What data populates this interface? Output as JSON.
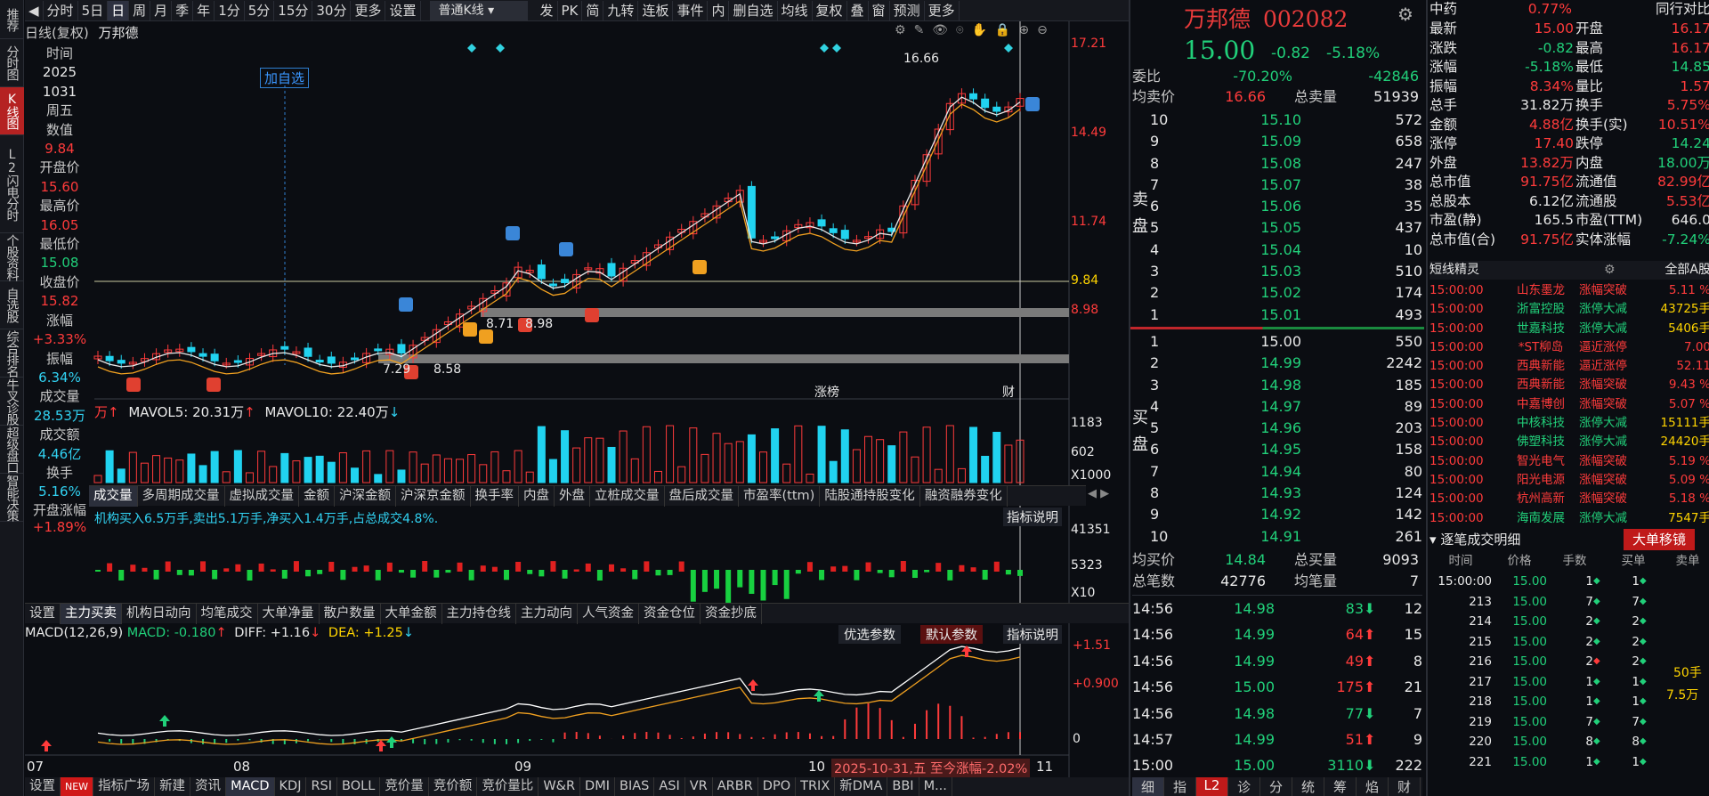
{
  "toolbar": {
    "items": [
      "分时",
      "5日",
      "日",
      "周",
      "月",
      "季",
      "年",
      "1分",
      "5分",
      "15分",
      "30分",
      "更多",
      "设置"
    ],
    "active": "日",
    "kline_select": "普通K线",
    "tools": [
      "发",
      "PK",
      "简",
      "九转",
      "连板",
      "事件",
      "内",
      "删自选",
      "均线",
      "复权",
      "叠",
      "窗",
      "预测",
      "更多"
    ]
  },
  "vnav": [
    "推荐",
    "分时图",
    "K线图",
    "L2闪电分时",
    "个股资料",
    "自选股",
    "综合排名",
    "牛叉诊股",
    "超级盘口",
    "智能决策"
  ],
  "chart_header": {
    "mode": "日线(复权)",
    "name": "万邦德",
    "add_watch": "加自选"
  },
  "info": {
    "labels": [
      "时间",
      "周五",
      "数值",
      "开盘价",
      "最高价",
      "最低价",
      "收盘价",
      "涨幅",
      "振幅",
      "成交量",
      "成交额",
      "换手",
      "开盘涨幅"
    ],
    "time_year": "2025",
    "time_date": "1031",
    "weekday": "周五",
    "value": "9.84",
    "open": "15.60",
    "high": "16.05",
    "low": "15.08",
    "close": "15.82",
    "chg": "+3.33%",
    "amp": "6.34%",
    "vol": "28.53万",
    "amt": "4.46亿",
    "turnover": "5.16%",
    "open_chg": "+1.89%"
  },
  "price_axis": [
    "17.21",
    "14.49",
    "11.74",
    "9.84",
    "8.98"
  ],
  "annotations": {
    "peak": "16.66",
    "low1": "7.29",
    "low2": "8.58",
    "mid1": "8.71",
    "mid2": "8.98",
    "zhangbang": "涨榜",
    "cai": "财"
  },
  "vol_header": {
    "mavol5": "MAVOL5: 20.31万",
    "mavol10": "MAVOL10: 22.40万"
  },
  "vol_axis": [
    "1183",
    "602",
    "X1000"
  ],
  "tabs_mid": [
    "成交量",
    "多周期成交量",
    "虚拟成交量",
    "金额",
    "沪深金额",
    "沪深京金额",
    "换手率",
    "内盘",
    "外盘",
    "立桩成交量",
    "盘后成交量",
    "市盈率(ttm)",
    "陆股通持股变化",
    "融资融券变化"
  ],
  "desc_line": "机构买入6.5万手,卖出5.1万手,净买入1.4万手,占总成交4.8%.",
  "desc_btn": "指标说明",
  "flow_axis": [
    "41351",
    "5323",
    "X10"
  ],
  "tabs_fund": [
    "设置",
    "主力买卖",
    "机构日动向",
    "均笔成交",
    "大单净量",
    "散户数量",
    "大单金额",
    "主力持仓线",
    "主力动向",
    "人气资金",
    "资金仓位",
    "资金抄底"
  ],
  "macd": {
    "name": "MACD(12,26,9)",
    "macd": "MACD: -0.180",
    "diff": "DIFF: +1.16",
    "dea": "DEA: +1.25",
    "btn1": "优选参数",
    "btn2": "默认参数",
    "btn3": "指标说明",
    "axis": [
      "+1.51",
      "+0.900",
      "0"
    ]
  },
  "xaxis": {
    "labels": [
      "07",
      "08",
      "09",
      "10",
      "11"
    ],
    "status": "2025-10-31,五 至今涨幅-2.02%"
  },
  "bottomtabs": [
    "设置",
    "NEW",
    "指标广场",
    "新建",
    "资讯",
    "MACD",
    "KDJ",
    "RSI",
    "BOLL",
    "竞价量",
    "竞价额",
    "竞价量比",
    "W&R",
    "DMI",
    "BIAS",
    "ASI",
    "VR",
    "ARBR",
    "DPO",
    "TRIX",
    "新DMA",
    "BBI",
    "M..."
  ],
  "stock": {
    "name": "万邦德",
    "code": "002082",
    "price": "15.00",
    "chg": "-0.82",
    "pct": "-5.18%",
    "webi_label": "委比",
    "webi": "-70.20%",
    "webi_num": "-42846",
    "avg_sell_label": "均卖价",
    "avg_sell": "16.66",
    "total_sell_label": "总卖量",
    "total_sell": "51939",
    "sell_label": "卖盘",
    "buy_label": "买盘",
    "asks": [
      [
        "10",
        "15.10",
        "572"
      ],
      [
        "9",
        "15.09",
        "658"
      ],
      [
        "8",
        "15.08",
        "247"
      ],
      [
        "7",
        "15.07",
        "38"
      ],
      [
        "6",
        "15.06",
        "35"
      ],
      [
        "5",
        "15.05",
        "437"
      ],
      [
        "4",
        "15.04",
        "10"
      ],
      [
        "3",
        "15.03",
        "510"
      ],
      [
        "2",
        "15.02",
        "174"
      ],
      [
        "1",
        "15.01",
        "493"
      ]
    ],
    "bids": [
      [
        "1",
        "15.00",
        "550"
      ],
      [
        "2",
        "14.99",
        "2242"
      ],
      [
        "3",
        "14.98",
        "185"
      ],
      [
        "4",
        "14.97",
        "89"
      ],
      [
        "5",
        "14.96",
        "203"
      ],
      [
        "6",
        "14.95",
        "158"
      ],
      [
        "7",
        "14.94",
        "80"
      ],
      [
        "8",
        "14.93",
        "124"
      ],
      [
        "9",
        "14.92",
        "142"
      ],
      [
        "10",
        "14.91",
        "261"
      ]
    ],
    "avg_buy_label": "均买价",
    "avg_buy": "14.84",
    "total_buy_label": "总买量",
    "total_buy": "9093",
    "total_cnt_label": "总笔数",
    "total_cnt": "42776",
    "avg_cnt_label": "均笔量",
    "avg_cnt": "7"
  },
  "ticks": [
    [
      "14:56",
      "14.98",
      "83",
      "12"
    ],
    [
      "14:56",
      "14.99",
      "64",
      "15"
    ],
    [
      "14:56",
      "14.99",
      "49",
      "8"
    ],
    [
      "14:56",
      "15.00",
      "175",
      "21"
    ],
    [
      "14:56",
      "14.98",
      "77",
      "7"
    ],
    [
      "14:57",
      "14.99",
      "51",
      "9"
    ],
    [
      "15:00",
      "15.00",
      "3110",
      "222"
    ]
  ],
  "ticks_dir": [
    "down",
    "up",
    "up",
    "up",
    "down",
    "up",
    "down"
  ],
  "ticks_tabs": [
    "细",
    "指",
    "L2",
    "诊",
    "分",
    "统",
    "筹",
    "焰",
    "财"
  ],
  "quote": {
    "industry": "中药",
    "industry_pct": "0.77%",
    "compare": "同行对比",
    "rows": [
      [
        "最新",
        "15.00",
        "开盘",
        "16.17"
      ],
      [
        "涨跌",
        "-0.82",
        "最高",
        "16.17"
      ],
      [
        "涨幅",
        "-5.18%",
        "最低",
        "14.85"
      ],
      [
        "振幅",
        "8.34%",
        "量比",
        "1.57"
      ],
      [
        "总手",
        "31.82万",
        "换手",
        "5.75%"
      ],
      [
        "金额",
        "4.88亿",
        "换手(实)",
        "10.51%"
      ],
      [
        "涨停",
        "17.40",
        "跌停",
        "14.24"
      ],
      [
        "外盘",
        "13.82万",
        "内盘",
        "18.00万"
      ],
      [
        "总市值",
        "91.75亿",
        "流通值",
        "82.99亿"
      ],
      [
        "总股本",
        "6.12亿",
        "流通股",
        "5.53亿"
      ],
      [
        "市盈(静)",
        "165.5",
        "市盈(TTM)",
        "646.0"
      ],
      [
        "总市值(合)",
        "91.75亿",
        "实体涨幅",
        "-7.24%"
      ]
    ],
    "colors": [
      [
        "red",
        "red"
      ],
      [
        "green",
        "red"
      ],
      [
        "green",
        "green"
      ],
      [
        "red",
        "red"
      ],
      [
        "white",
        "red"
      ],
      [
        "red",
        "red"
      ],
      [
        "red",
        "green"
      ],
      [
        "red",
        "green"
      ],
      [
        "red",
        "red"
      ],
      [
        "white",
        "red"
      ],
      [
        "white",
        "white"
      ],
      [
        "red",
        "green"
      ]
    ]
  },
  "news": {
    "title": "短线精灵",
    "filter": "全部A股",
    "items": [
      [
        "15:00:00",
        "山东墨龙",
        "涨幅突破",
        "5.11 %"
      ],
      [
        "15:00:00",
        "浙富控股",
        "涨停大减",
        "43725手"
      ],
      [
        "15:00:00",
        "世嘉科技",
        "涨停大减",
        "5406手"
      ],
      [
        "15:00:00",
        "*ST柳岛",
        "逼近涨停",
        "7.00"
      ],
      [
        "15:00:00",
        "西典新能",
        "逼近涨停",
        "52.11"
      ],
      [
        "15:00:00",
        "西典新能",
        "涨幅突破",
        "9.43 %"
      ],
      [
        "15:00:00",
        "中嘉博创",
        "涨幅突破",
        "5.07 %"
      ],
      [
        "15:00:00",
        "中核科技",
        "涨停大减",
        "15111手"
      ],
      [
        "15:00:00",
        "佛塑科技",
        "涨停大减",
        "24420手"
      ],
      [
        "15:00:00",
        "智光电气",
        "涨幅突破",
        "5.19 %"
      ],
      [
        "15:00:00",
        "阳光电源",
        "涨幅突破",
        "5.09 %"
      ],
      [
        "15:00:00",
        "杭州高新",
        "涨幅突破",
        "5.18 %"
      ],
      [
        "15:00:00",
        "海南发展",
        "涨停大减",
        "7547手"
      ]
    ]
  },
  "deals": {
    "title": "逐笔成交明细",
    "btn": "大单移镜",
    "cols": [
      "时间",
      "价格",
      "手数",
      "买单",
      "卖单"
    ],
    "rows": [
      [
        "15:00:00",
        "15.00",
        "1",
        "1"
      ],
      [
        "213",
        "15.00",
        "7",
        "7"
      ],
      [
        "214",
        "15.00",
        "2",
        "2"
      ],
      [
        "215",
        "15.00",
        "2",
        "2"
      ],
      [
        "216",
        "15.00",
        "2",
        "2"
      ],
      [
        "217",
        "15.00",
        "1",
        "1"
      ],
      [
        "218",
        "15.00",
        "1",
        "1"
      ],
      [
        "219",
        "15.00",
        "7",
        "7"
      ],
      [
        "220",
        "15.00",
        "8",
        "8"
      ],
      [
        "221",
        "15.00",
        "1",
        "1"
      ]
    ],
    "side": [
      "50手",
      "7.5万"
    ]
  },
  "colors": {
    "up": "#ff3b3b",
    "down": "#21d3f0",
    "green": "#21d07a",
    "yellow": "#ffd400",
    "bg": "#0b0d12",
    "grid": "#2a2d35"
  }
}
